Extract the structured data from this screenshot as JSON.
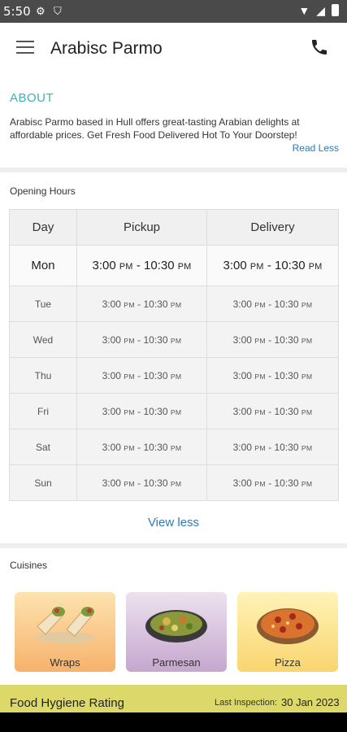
{
  "status_bar": {
    "time": "5:50"
  },
  "header": {
    "title": "Arabisc Parmo"
  },
  "about": {
    "heading": "ABOUT",
    "text": "Arabisc Parmo based in Hull offers great-tasting Arabian delights at affordable prices. Get Fresh Food Delivered Hot To Your Doorstep!",
    "read_less": "Read Less"
  },
  "hours": {
    "label": "Opening Hours",
    "columns": [
      "Day",
      "Pickup",
      "Delivery"
    ],
    "rows": [
      {
        "day": "Mon",
        "pickup_open": "3:00",
        "pickup_open_ampm": "PM",
        "pickup_close": "10:30",
        "pickup_close_ampm": "PM",
        "delivery_open": "3:00",
        "delivery_open_ampm": "PM",
        "delivery_close": "10:30",
        "delivery_close_ampm": "PM"
      },
      {
        "day": "Tue",
        "pickup_open": "3:00",
        "pickup_open_ampm": "PM",
        "pickup_close": "10:30",
        "pickup_close_ampm": "PM",
        "delivery_open": "3:00",
        "delivery_open_ampm": "PM",
        "delivery_close": "10:30",
        "delivery_close_ampm": "PM"
      },
      {
        "day": "Wed",
        "pickup_open": "3:00",
        "pickup_open_ampm": "PM",
        "pickup_close": "10:30",
        "pickup_close_ampm": "PM",
        "delivery_open": "3:00",
        "delivery_open_ampm": "PM",
        "delivery_close": "10:30",
        "delivery_close_ampm": "PM"
      },
      {
        "day": "Thu",
        "pickup_open": "3:00",
        "pickup_open_ampm": "PM",
        "pickup_close": "10:30",
        "pickup_close_ampm": "PM",
        "delivery_open": "3:00",
        "delivery_open_ampm": "PM",
        "delivery_close": "10:30",
        "delivery_close_ampm": "PM"
      },
      {
        "day": "Fri",
        "pickup_open": "3:00",
        "pickup_open_ampm": "PM",
        "pickup_close": "10:30",
        "pickup_close_ampm": "PM",
        "delivery_open": "3:00",
        "delivery_open_ampm": "PM",
        "delivery_close": "10:30",
        "delivery_close_ampm": "PM"
      },
      {
        "day": "Sat",
        "pickup_open": "3:00",
        "pickup_open_ampm": "PM",
        "pickup_close": "10:30",
        "pickup_close_ampm": "PM",
        "delivery_open": "3:00",
        "delivery_open_ampm": "PM",
        "delivery_close": "10:30",
        "delivery_close_ampm": "PM"
      },
      {
        "day": "Sun",
        "pickup_open": "3:00",
        "pickup_open_ampm": "PM",
        "pickup_close": "10:30",
        "pickup_close_ampm": "PM",
        "delivery_open": "3:00",
        "delivery_open_ampm": "PM",
        "delivery_close": "10:30",
        "delivery_close_ampm": "PM"
      }
    ],
    "separator": " - ",
    "view_less": "View less"
  },
  "cuisines": {
    "label": "Cuisines",
    "items": [
      {
        "name": "Wraps",
        "icon": "wrap-icon"
      },
      {
        "name": "Parmesan",
        "icon": "salad-bowl-icon"
      },
      {
        "name": "Pizza",
        "icon": "pizza-icon"
      }
    ]
  },
  "hygiene": {
    "title": "Food Hygiene Rating",
    "last_inspection_label": "Last Inspection:",
    "last_inspection_date": "30 Jan 2023"
  },
  "colors": {
    "accent": "#3ab3b3",
    "link": "#2b7bb9",
    "hygiene_bg": "#dcd96a"
  }
}
